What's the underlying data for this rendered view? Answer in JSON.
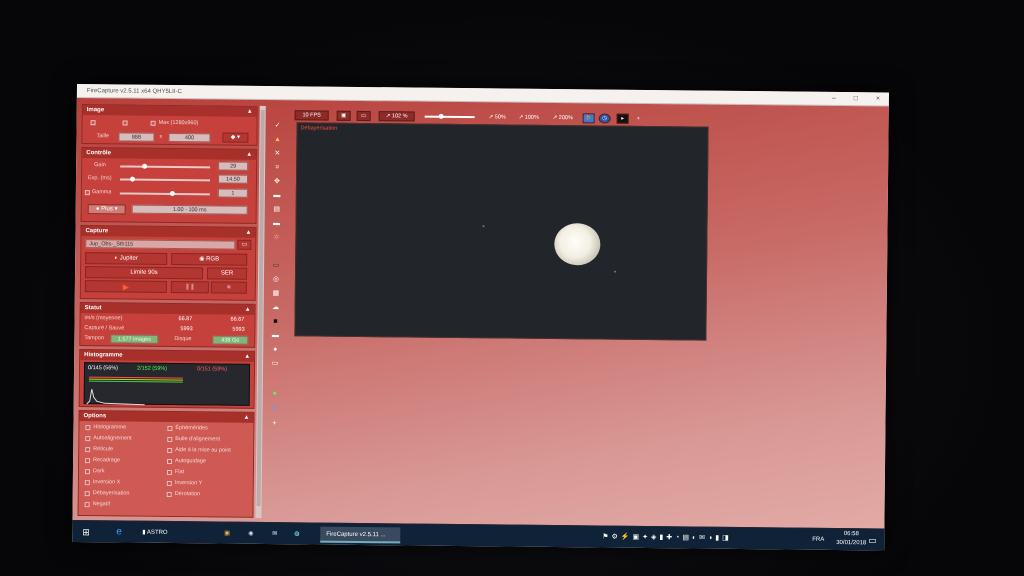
{
  "window": {
    "title": "FireCapture v2.5.11 x64   QHY5LII-C",
    "buttons": [
      "–",
      "□",
      "×"
    ]
  },
  "image": {
    "header": "Image",
    "max_label": "Max (1280x960)",
    "size_label": "Taille",
    "width": "888",
    "x_label": "x",
    "height": "400"
  },
  "controls": {
    "header": "Contrôle",
    "gain_label": "Gain",
    "gain_value": "29",
    "exp_label": "Exp. (ms)",
    "exp_value": "14.50",
    "gamma_label": "Gamma",
    "gamma_value": "1",
    "plus_label": "Plus",
    "range": "1.00 - 100 ms"
  },
  "capture": {
    "header": "Capture",
    "filename": "Jup_Obs-_Sth115",
    "object_button": "Jupiter",
    "color_button": "RGB",
    "limit_button": "Limite 90s",
    "format_button": "SER"
  },
  "status": {
    "header": "Statut",
    "rows": [
      {
        "label": "im/s (moyenne)",
        "v1": "66.87",
        "v2": "66.67"
      },
      {
        "label": "Capturé / Sauvé",
        "v1": "5993",
        "v2": "5993"
      }
    ],
    "tampon_label": "Tampon",
    "tampon_value": "1.577 images",
    "disque_label": "Disque",
    "disque_value": "438 Go"
  },
  "histogram": {
    "header": "Histogramme",
    "r": "0/145 (56%)",
    "g": "2/152 (59%)",
    "b": "0/151 (59%)",
    "colors": {
      "r": "#ffffff",
      "g": "#4cff4c",
      "b": "#ff6060"
    }
  },
  "options": {
    "header": "Options",
    "left": [
      "Histogramme",
      "Autoalignement",
      "Réticule",
      "Recadrage",
      "Dark",
      "Inversion X",
      "Débayerisation",
      "Negatif"
    ],
    "right": [
      "Éphémérides",
      "Bulle d'alignement",
      "Aide à la mise au point",
      "Autoguidage",
      "Flat",
      "Inversion Y",
      "Dérotation"
    ]
  },
  "topbar": {
    "fps": "10 FPS",
    "zoom": "102 %",
    "z50": "50%",
    "z100": "100%",
    "z200": "200%",
    "plus": "+"
  },
  "viewport": {
    "overlay": "Débayerisation"
  },
  "taskbar": {
    "app1": "ASTRO",
    "app2": "FireCapture v2.5.11 ...",
    "lang": "FRA",
    "time": "06:58",
    "date": "30/01/2018"
  },
  "accent": "#c6413b"
}
